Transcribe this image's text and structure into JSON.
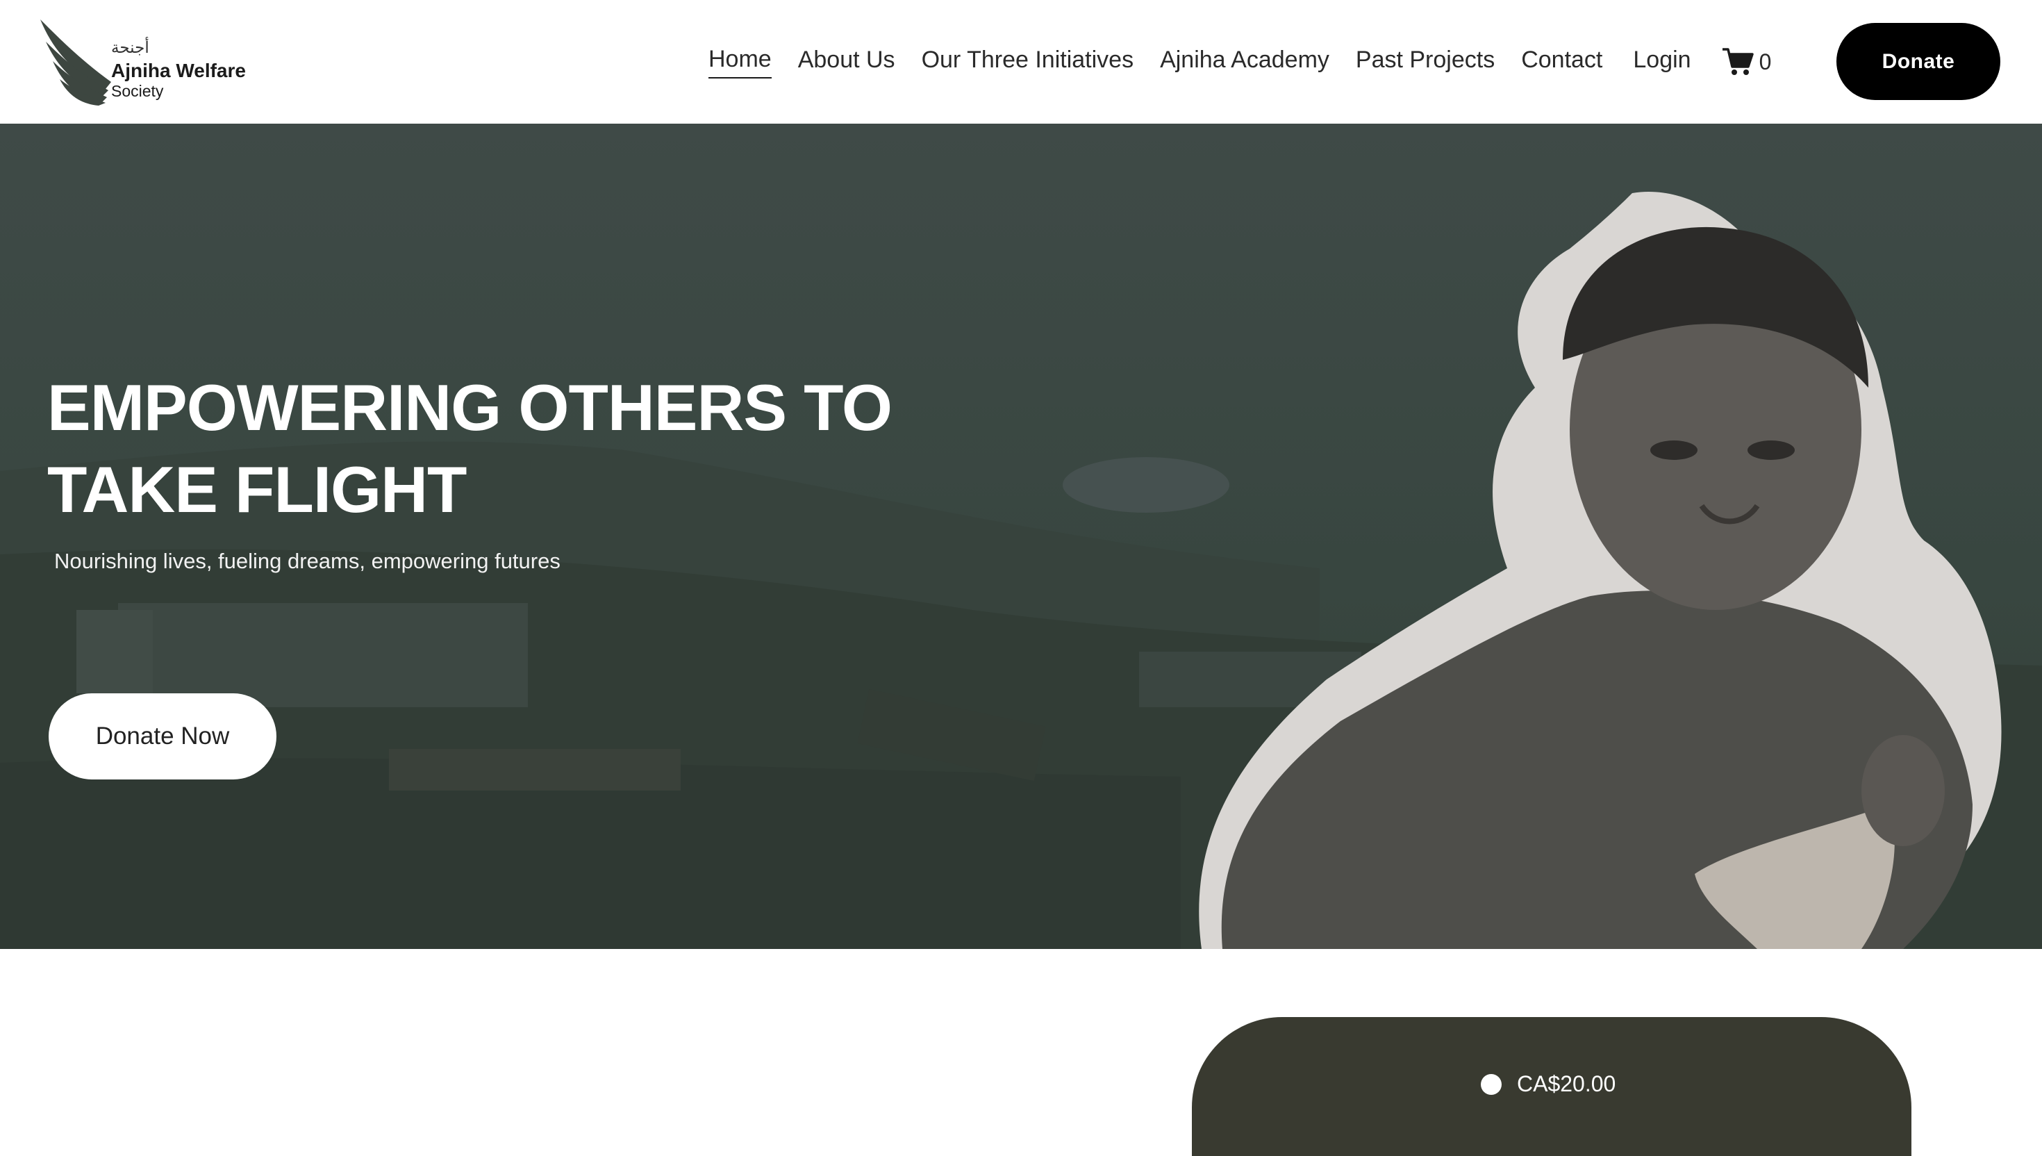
{
  "brand": {
    "arabic_name": "أجنحة",
    "name": "Ajniha Welfare",
    "sub": "Society"
  },
  "nav": {
    "items": [
      {
        "label": "Home",
        "active": true
      },
      {
        "label": "About Us"
      },
      {
        "label": "Our Three Initiatives"
      },
      {
        "label": "Ajniha Academy"
      },
      {
        "label": "Past Projects"
      },
      {
        "label": "Contact"
      }
    ],
    "login": "Login",
    "cart_count": "0",
    "donate_label": "Donate"
  },
  "hero": {
    "title_line1": "EMPOWERING OTHERS TO",
    "title_line2": "TAKE FLIGHT",
    "subtitle": "Nourishing lives, fueling dreams, empowering futures",
    "cta_label": "Donate Now"
  },
  "donation": {
    "amount_label": "CA$20.00"
  },
  "colors": {
    "hero_overlay": "#3b4843",
    "panel": "#393a30",
    "button_dark": "#000000"
  },
  "icons": [
    "wing-logo-icon",
    "cart-icon",
    "radio-icon"
  ]
}
